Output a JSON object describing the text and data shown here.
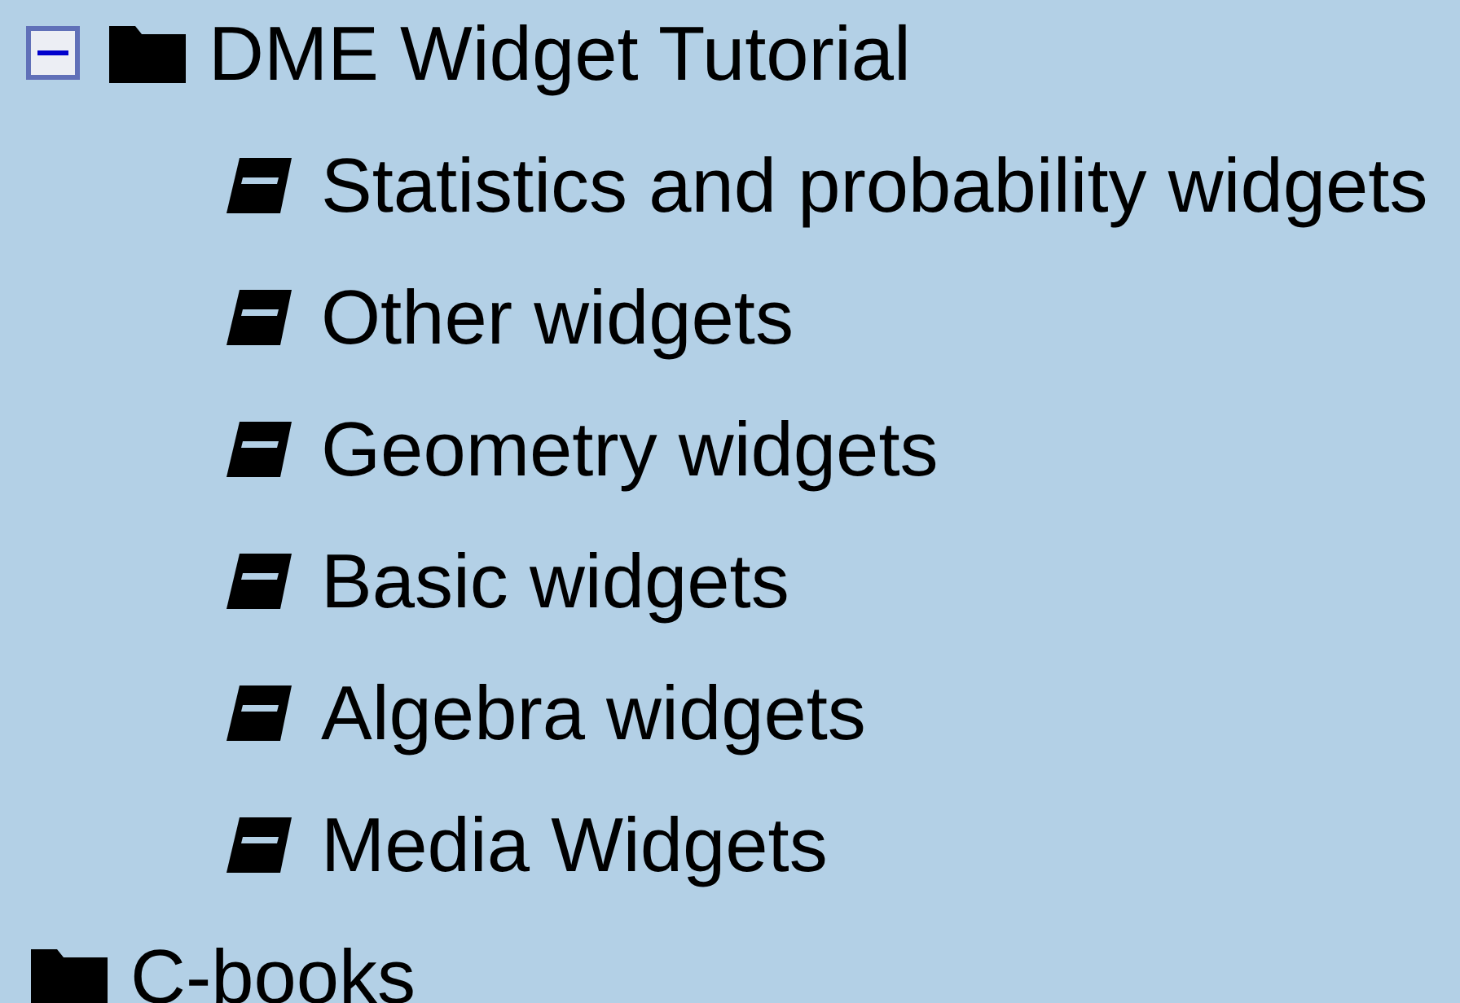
{
  "tree": [
    {
      "label": "DME Widget Tutorial",
      "kind": "folder",
      "expanded": true,
      "children": [
        {
          "label": "Statistics and probability widgets",
          "kind": "book"
        },
        {
          "label": "Other widgets",
          "kind": "book"
        },
        {
          "label": "Geometry widgets",
          "kind": "book"
        },
        {
          "label": "Basic widgets",
          "kind": "book"
        },
        {
          "label": "Algebra widgets",
          "kind": "book"
        },
        {
          "label": "Media Widgets",
          "kind": "book"
        }
      ]
    },
    {
      "label": "C-books",
      "kind": "folder"
    }
  ]
}
